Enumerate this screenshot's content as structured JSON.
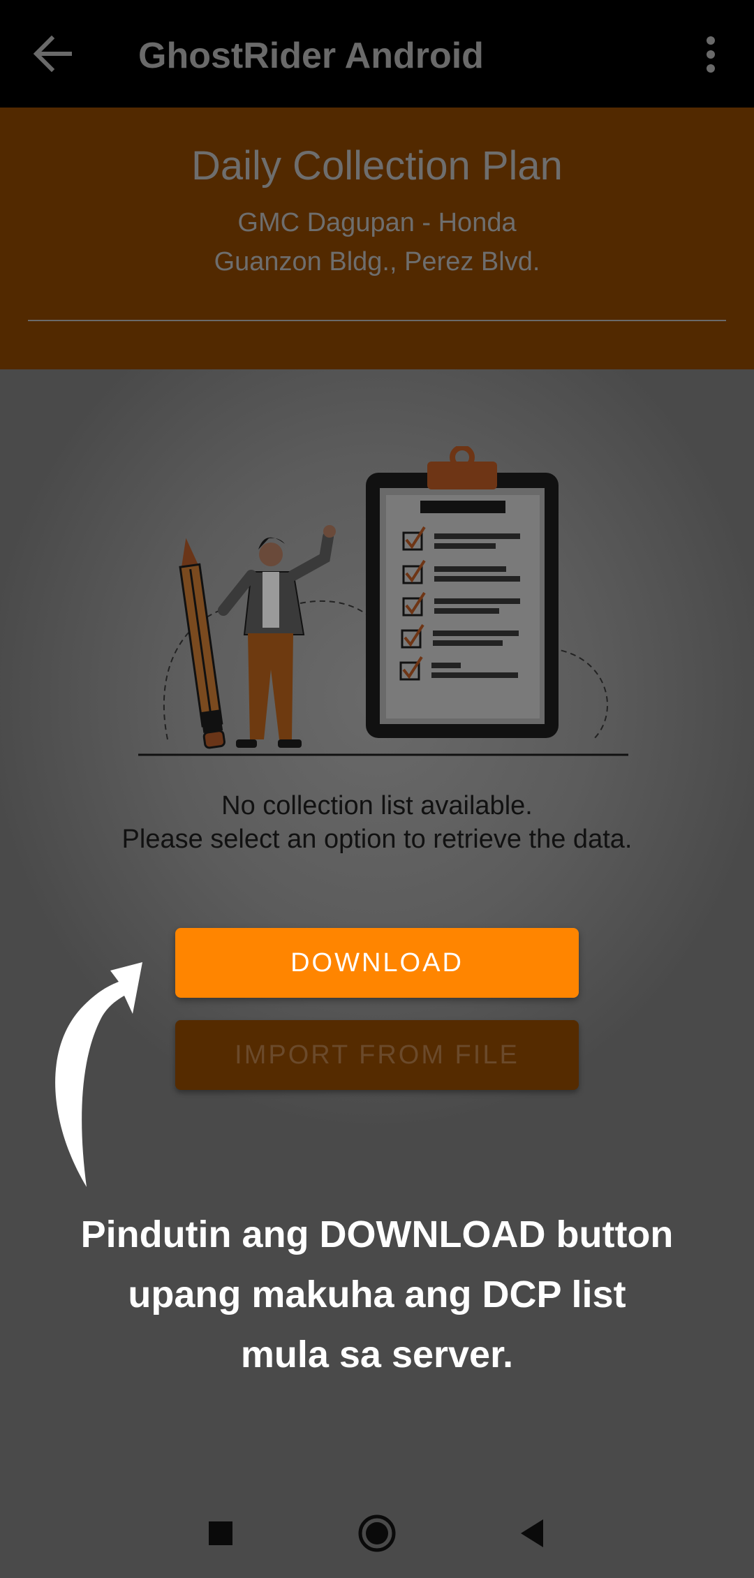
{
  "appbar": {
    "title": "GhostRider Android",
    "back_icon": "arrow-left-icon",
    "menu_icon": "more-vertical-icon"
  },
  "header": {
    "title": "Daily Collection Plan",
    "branch": "GMC Dagupan - Honda",
    "address": "Guanzon Bldg., Perez Blvd."
  },
  "empty_state": {
    "line1": "No collection list available.",
    "line2": "Please select an option to retrieve the data."
  },
  "actions": {
    "download_label": "DOWNLOAD",
    "import_label": "IMPORT FROM FILE"
  },
  "tutorial": {
    "line1": "Pindutin ang DOWNLOAD button",
    "line2": "upang makuha ang DCP list",
    "line3": "mula sa server."
  },
  "colors": {
    "accent": "#ff8500",
    "header_bg": "#522900",
    "appbar_bg": "#000000"
  },
  "navbar": {
    "recent_icon": "square-icon",
    "home_icon": "circle-icon",
    "back_icon": "triangle-back-icon"
  }
}
